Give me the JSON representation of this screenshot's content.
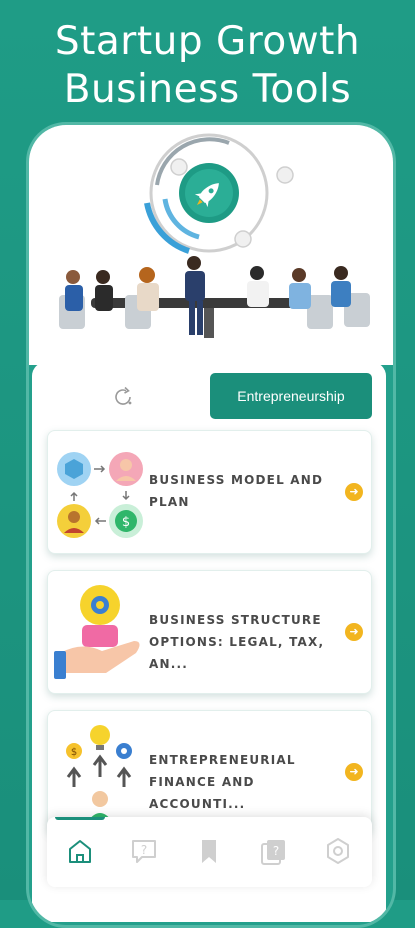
{
  "headline": {
    "line1": "Startup Growth",
    "line2": "Business Tools"
  },
  "hero": {
    "logo_icon": "rocket-icon",
    "illustration": "business-meeting-illustration"
  },
  "topbar": {
    "refresh_icon": "refresh-icon",
    "active_tab_label": "Entrepreneurship"
  },
  "cards": [
    {
      "title": "BUSINESS MODEL AND PLAN",
      "icon": "business-model-flow-icon"
    },
    {
      "title": "BUSINESS STRUCTURE OPTIONS: LEGAL, TAX, AN...",
      "icon": "hand-gear-icon"
    },
    {
      "title": "ENTREPRENEURIAL FINANCE AND ACCOUNTI...",
      "icon": "finance-growth-icon"
    }
  ],
  "bottom_nav": {
    "items": [
      {
        "icon": "home-icon",
        "active": true
      },
      {
        "icon": "question-chat-icon",
        "active": false
      },
      {
        "icon": "bookmark-icon",
        "active": false
      },
      {
        "icon": "quiz-cards-icon",
        "active": false
      },
      {
        "icon": "settings-icon",
        "active": false
      }
    ]
  },
  "colors": {
    "background": "#1f9c86",
    "accent": "#1b8f7b",
    "arrow_badge": "#f2b51f"
  }
}
